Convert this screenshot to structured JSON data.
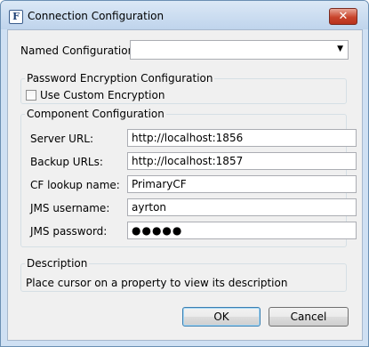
{
  "window": {
    "title": "Connection Configuration",
    "close_glyph": "✕",
    "icon_letter": "F"
  },
  "named_config": {
    "label": "Named Configuration",
    "value": "",
    "arrow": "▼"
  },
  "encryption": {
    "group_title": "Password Encryption Configuration",
    "checkbox_label": "Use Custom Encryption",
    "checked": false
  },
  "component": {
    "group_title": "Component Configuration",
    "fields": [
      {
        "label": "Server URL:",
        "value": "http://localhost:1856"
      },
      {
        "label": "Backup URLs:",
        "value": "http://localhost:1857"
      },
      {
        "label": "CF lookup name:",
        "value": "PrimaryCF"
      },
      {
        "label": "JMS username:",
        "value": "ayrton"
      },
      {
        "label": "JMS password:",
        "value": "●●●●●"
      }
    ]
  },
  "description": {
    "group_title": "Description",
    "text": "Place cursor on a property to view its description"
  },
  "buttons": {
    "ok": "OK",
    "cancel": "Cancel"
  }
}
